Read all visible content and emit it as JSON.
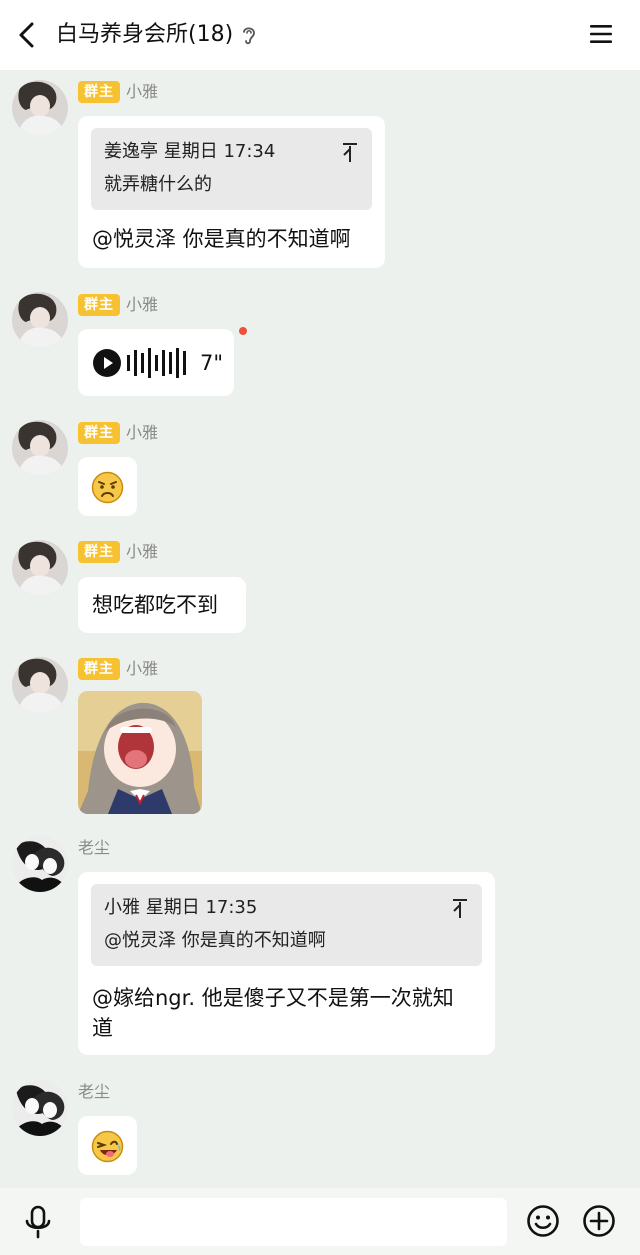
{
  "header": {
    "title": "白马养身会所(18)",
    "back_icon": "back-chevron-icon",
    "ear_icon": "ear-icon",
    "menu_icon": "menu-icon"
  },
  "messages": [
    {
      "sender": "小雅",
      "badge": "群主",
      "quote": {
        "author_time": "姜逸亭 星期日 17:34",
        "text": "就弄糖什么的"
      },
      "text": "@悦灵泽 你是真的不知道啊"
    },
    {
      "sender": "小雅",
      "badge": "群主",
      "voice_duration": "7\""
    },
    {
      "sender": "小雅",
      "badge": "群主",
      "emoji": "sad-face-emoji"
    },
    {
      "sender": "小雅",
      "badge": "群主",
      "text": "想吃都吃不到"
    },
    {
      "sender": "小雅",
      "badge": "群主",
      "sticker": "anime-girl-laughing-sticker"
    },
    {
      "sender": "老尘",
      "quote": {
        "author_time": "小雅 星期日 17:35",
        "text": "@悦灵泽 你是真的不知道啊"
      },
      "text_line1": "@嫁给ngr. 他是傻子又不是第一次就知",
      "text_line2": "道"
    },
    {
      "sender": "老尘",
      "emoji": "laughing-tongue-emoji"
    }
  ],
  "colors": {
    "chat_background": "#edf1ee",
    "badge": "#f6c232",
    "unread_dot": "#f04f3d",
    "bubble": "#ffffff",
    "quote_background": "#e9e9e9"
  },
  "footer": {
    "mic_icon": "microphone-icon",
    "input_value": "",
    "emoji_icon": "smiley-icon",
    "plus_icon": "plus-circle-icon"
  }
}
